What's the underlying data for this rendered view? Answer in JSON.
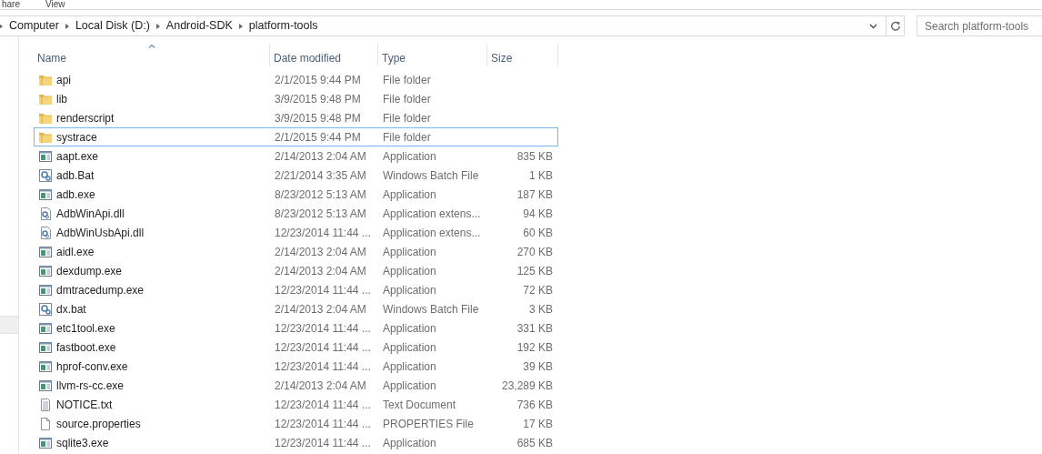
{
  "ribbon_tabs": [
    {
      "label": "hare"
    },
    {
      "label": "View"
    }
  ],
  "breadcrumb": [
    "Computer",
    "Local Disk (D:)",
    "Android-SDK",
    "platform-tools"
  ],
  "search": {
    "placeholder": "Search platform-tools"
  },
  "columns": [
    {
      "label": "Name",
      "sorted": true
    },
    {
      "label": "Date modified",
      "sorted": false
    },
    {
      "label": "Type",
      "sorted": false
    },
    {
      "label": "Size",
      "sorted": false
    }
  ],
  "rows": [
    {
      "kind": "folder",
      "name": "api",
      "date": "2/1/2015 9:44 PM",
      "type": "File folder",
      "selected": false
    },
    {
      "kind": "folder",
      "name": "lib",
      "date": "3/9/2015 9:48 PM",
      "type": "File folder",
      "selected": false
    },
    {
      "kind": "folder",
      "name": "renderscript",
      "date": "3/9/2015 9:48 PM",
      "type": "File folder",
      "selected": false
    },
    {
      "kind": "folder",
      "name": "systrace",
      "date": "2/1/2015 9:44 PM",
      "type": "File folder",
      "selected": true
    },
    {
      "kind": "application",
      "name": "aapt.exe",
      "date": "2/14/2013 2:04 AM",
      "type": "Application",
      "size": "835 KB",
      "selected": false
    },
    {
      "kind": "batch",
      "name": "adb.Bat",
      "date": "2/21/2014 3:35 AM",
      "type": "Windows Batch File",
      "size": "1 KB",
      "selected": false
    },
    {
      "kind": "application",
      "name": "adb.exe",
      "date": "8/23/2012 5:13 AM",
      "type": "Application",
      "size": "187 KB",
      "selected": false
    },
    {
      "kind": "dll",
      "name": "AdbWinApi.dll",
      "date": "8/23/2012 5:13 AM",
      "type": "Application extens...",
      "size": "94 KB",
      "selected": false
    },
    {
      "kind": "dll",
      "name": "AdbWinUsbApi.dll",
      "date": "12/23/2014 11:44 ...",
      "type": "Application extens...",
      "size": "60 KB",
      "selected": false
    },
    {
      "kind": "application",
      "name": "aidl.exe",
      "date": "2/14/2013 2:04 AM",
      "type": "Application",
      "size": "270 KB",
      "selected": false
    },
    {
      "kind": "application",
      "name": "dexdump.exe",
      "date": "2/14/2013 2:04 AM",
      "type": "Application",
      "size": "125 KB",
      "selected": false
    },
    {
      "kind": "application",
      "name": "dmtracedump.exe",
      "date": "12/23/2014 11:44 ...",
      "type": "Application",
      "size": "72 KB",
      "selected": false
    },
    {
      "kind": "batch",
      "name": "dx.bat",
      "date": "2/14/2013 2:04 AM",
      "type": "Windows Batch File",
      "size": "3 KB",
      "selected": false
    },
    {
      "kind": "application",
      "name": "etc1tool.exe",
      "date": "12/23/2014 11:44 ...",
      "type": "Application",
      "size": "331 KB",
      "selected": false
    },
    {
      "kind": "application",
      "name": "fastboot.exe",
      "date": "12/23/2014 11:44 ...",
      "type": "Application",
      "size": "192 KB",
      "selected": false
    },
    {
      "kind": "application",
      "name": "hprof-conv.exe",
      "date": "12/23/2014 11:44 ...",
      "type": "Application",
      "size": "39 KB",
      "selected": false
    },
    {
      "kind": "application",
      "name": "llvm-rs-cc.exe",
      "date": "2/14/2013 2:04 AM",
      "type": "Application",
      "size": "23,289 KB",
      "selected": false
    },
    {
      "kind": "text",
      "name": "NOTICE.txt",
      "date": "12/23/2014 11:44 ...",
      "type": "Text Document",
      "size": "736 KB",
      "selected": false
    },
    {
      "kind": "file",
      "name": "source.properties",
      "date": "12/23/2014 11:44 ...",
      "type": "PROPERTIES File",
      "size": "17 KB",
      "selected": false
    },
    {
      "kind": "application",
      "name": "sqlite3.exe",
      "date": "12/23/2014 11:44 ...",
      "type": "Application",
      "size": "685 KB",
      "selected": false
    }
  ]
}
